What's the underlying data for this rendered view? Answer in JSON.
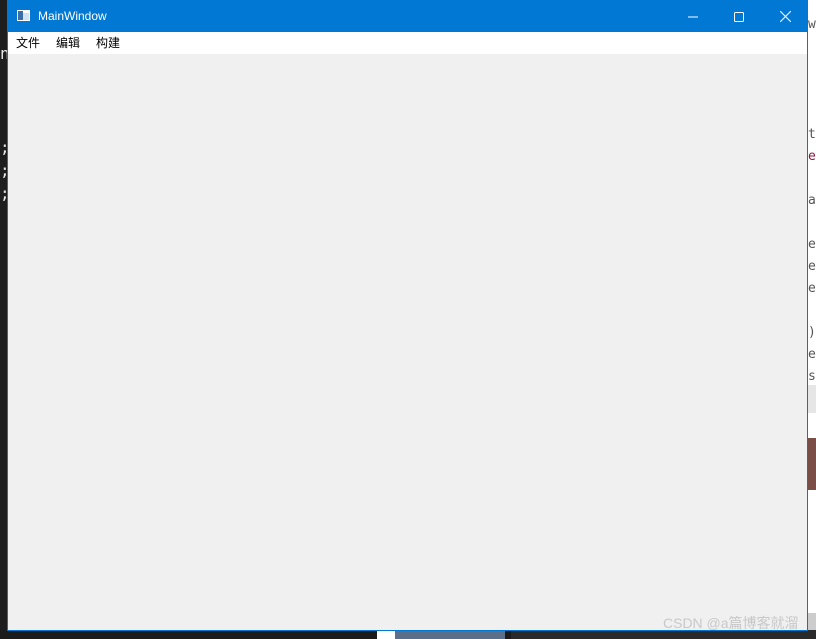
{
  "window": {
    "title": "MainWindow",
    "icon": "app-window-icon",
    "controls": {
      "minimize": "minimize-icon",
      "maximize": "maximize-icon",
      "close": "close-icon"
    },
    "accent_color": "#0078d4",
    "client_background": "#f0f0f0"
  },
  "menu": {
    "items": [
      {
        "label": "文件"
      },
      {
        "label": "编辑"
      },
      {
        "label": "构建"
      }
    ]
  },
  "background": {
    "left_fragments": [
      "n",
      ";",
      ";",
      ";"
    ],
    "right_fragments": [
      "w",
      "t",
      "ew",
      "a",
      "en",
      "en",
      "en",
      ")",
      "e }",
      "s }"
    ]
  },
  "watermark": "CSDN @a篇博客就溜"
}
